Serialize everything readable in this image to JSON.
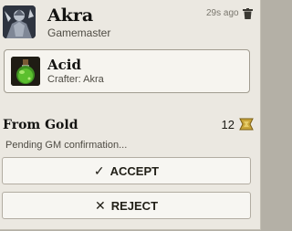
{
  "message": {
    "sender": {
      "name": "Akra",
      "role": "Gamemaster",
      "avatar_icon": "armored-figure-avatar"
    },
    "timestamp": "29s ago",
    "delete_icon": "trash-icon"
  },
  "item": {
    "name": "Acid",
    "crafter_text": "Crafter: Akra",
    "icon": "green-potion-flask-icon"
  },
  "transaction": {
    "source_label": "From Gold",
    "amount": "12",
    "currency_icon": "gold-coin-icon",
    "status": "Pending GM confirmation..."
  },
  "actions": {
    "accept_glyph": "✓",
    "accept_label": "ACCEPT",
    "reject_glyph": "✕",
    "reject_label": "REJECT"
  },
  "colors": {
    "background": "#ebe8e1",
    "border": "#a19c90",
    "text": "#191813"
  }
}
